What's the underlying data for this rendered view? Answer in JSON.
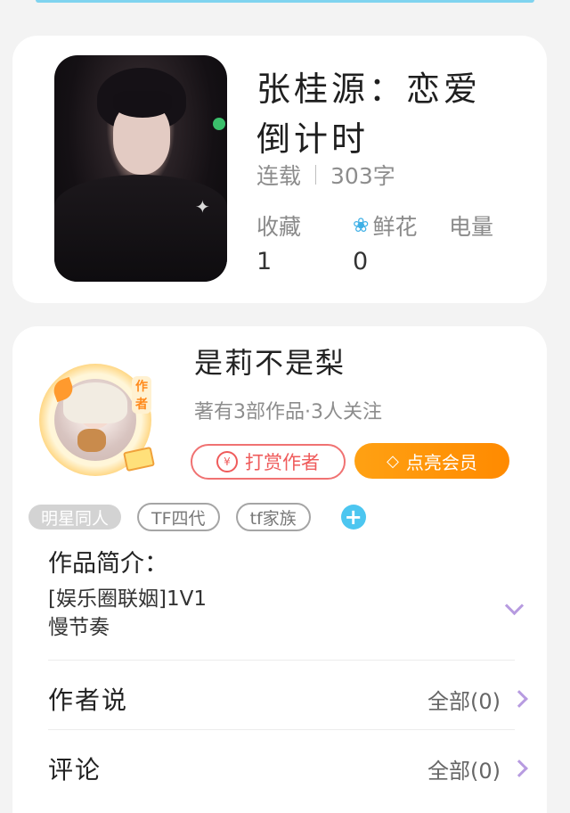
{
  "book": {
    "title_line1": "张桂源：恋爱",
    "title_line2": "倒计时",
    "status": "连载",
    "word_count": "303字",
    "stats": [
      {
        "label": "收藏",
        "value": "1"
      },
      {
        "label": "鲜花",
        "value": "0",
        "icon": "flower-icon"
      },
      {
        "label": "电量",
        "value": ""
      }
    ]
  },
  "author": {
    "name": "是莉不是梨",
    "info": "著有3部作品·3人关注",
    "badge": "作者",
    "tip_button": "打赏作者",
    "tip_icon": "¥",
    "vip_button": "点亮会员",
    "tags": [
      "明星同人",
      "TF四代",
      "tf家族"
    ]
  },
  "intro": {
    "title": "作品简介：",
    "line1": "[娱乐圈联姻]1V1",
    "line2": "慢节奏"
  },
  "rows": {
    "author_says": {
      "label": "作者说",
      "value": "全部(0)"
    },
    "comments": {
      "label": "评论",
      "value": "全部(0)"
    }
  },
  "colors": {
    "accent_orange": "#ff9a0a",
    "tip_red": "#ef5b5b",
    "chevron_purple": "#b79be0",
    "plus_blue": "#4cc6f0"
  }
}
